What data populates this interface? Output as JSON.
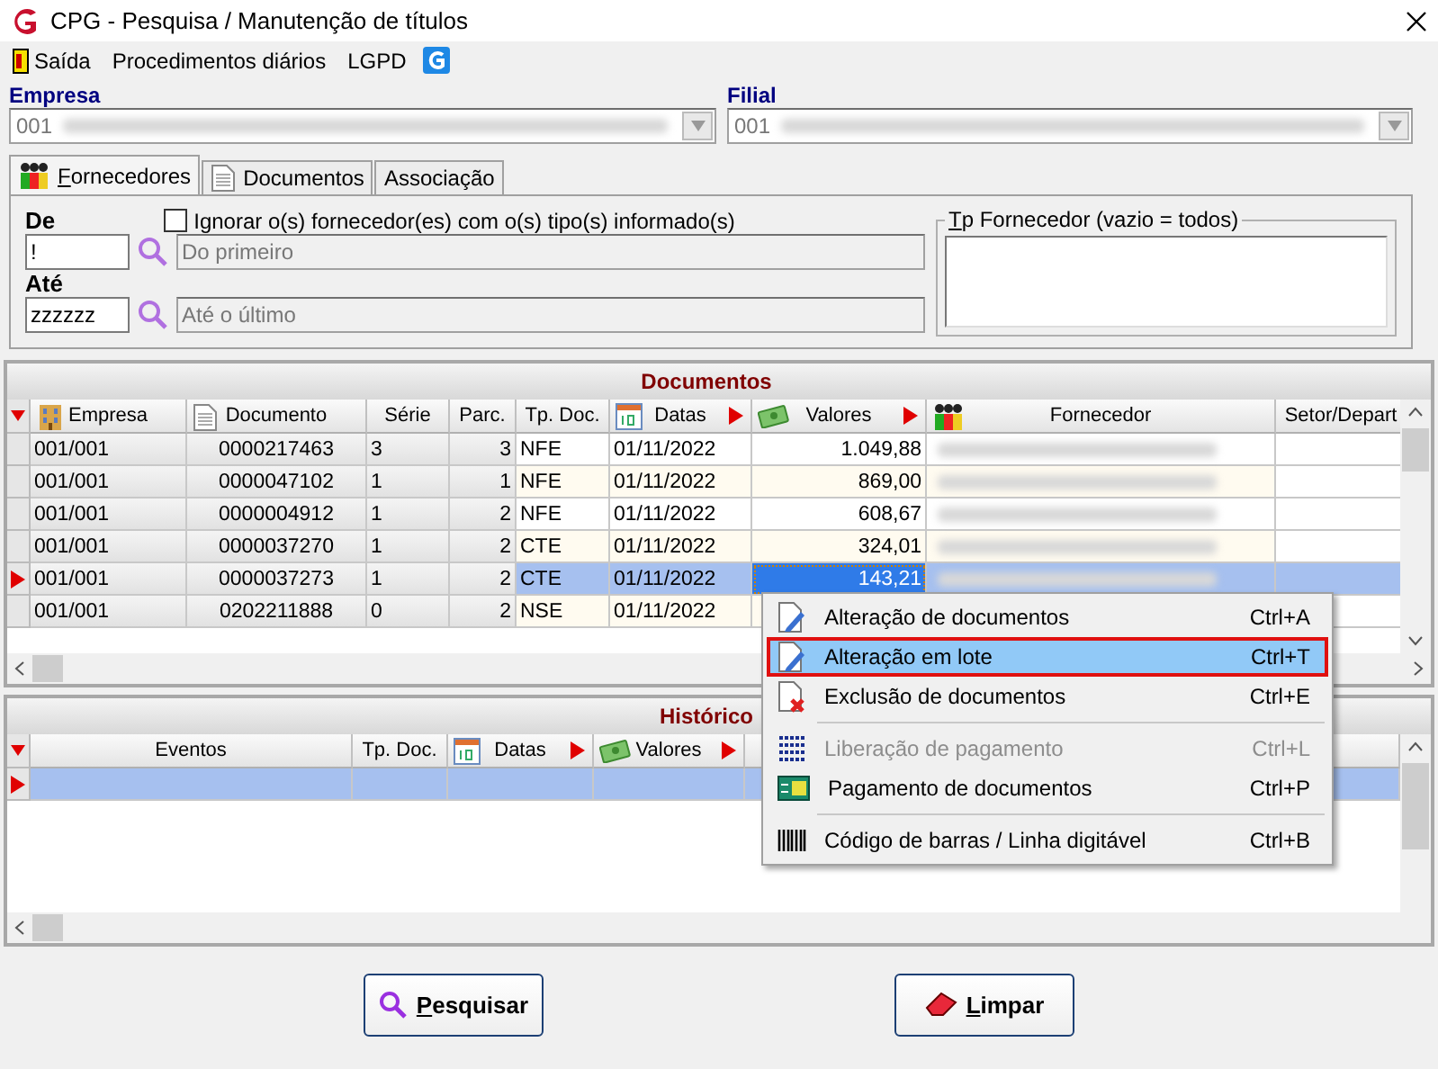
{
  "window": {
    "title": "CPG - Pesquisa / Manutenção de títulos"
  },
  "menu": [
    {
      "label": "Saída",
      "kind": "exit"
    },
    {
      "label": "Procedimentos diários",
      "kind": "text"
    },
    {
      "label": "LGPD",
      "kind": "text"
    }
  ],
  "empresa": {
    "label": "Empresa",
    "value": "001"
  },
  "filial": {
    "label": "Filial",
    "value": "001"
  },
  "tabs": [
    {
      "label": "Fornecedores",
      "selected": true,
      "kind": "supplier"
    },
    {
      "label": "Documentos",
      "selected": false,
      "kind": "document"
    },
    {
      "label": "Associação",
      "selected": false,
      "kind": "text"
    }
  ],
  "filter": {
    "from_label": "De",
    "from_value": "!",
    "from_placeholder": "Do primeiro",
    "to_label": "Até",
    "to_value": "zzzzzz",
    "to_placeholder": "Até o último",
    "ignore": {
      "label": "Ignorar o(s) fornecedor(es) com o(s) tipo(s) informado(s)",
      "checked": false
    },
    "type_group": "Tp Fornecedor (vazio = todos)"
  },
  "documents": {
    "title": "Documentos",
    "columns": [
      {
        "label": "Empresa",
        "kind": "company"
      },
      {
        "label": "Documento",
        "kind": "document"
      },
      {
        "label": "Série",
        "kind": "plain"
      },
      {
        "label": "Parc.",
        "kind": "plain"
      },
      {
        "label": "Tp. Doc.",
        "kind": "plain"
      },
      {
        "label": "Datas",
        "kind": "date"
      },
      {
        "label": "Valores",
        "kind": "money"
      },
      {
        "label": "Fornecedor",
        "kind": "supplier"
      },
      {
        "label": "Setor/Depart",
        "kind": "plain"
      }
    ],
    "rows": [
      {
        "empresa": "001/001",
        "documento": "0000217463",
        "serie": "3",
        "parcela": "3",
        "tipo": "NFE",
        "data": "01/11/2022",
        "valor": "1.049,88",
        "selected": false
      },
      {
        "empresa": "001/001",
        "documento": "0000047102",
        "serie": "1",
        "parcela": "1",
        "tipo": "NFE",
        "data": "01/11/2022",
        "valor": "869,00",
        "selected": false
      },
      {
        "empresa": "001/001",
        "documento": "0000004912",
        "serie": "1",
        "parcela": "2",
        "tipo": "NFE",
        "data": "01/11/2022",
        "valor": "608,67",
        "selected": false
      },
      {
        "empresa": "001/001",
        "documento": "0000037270",
        "serie": "1",
        "parcela": "2",
        "tipo": "CTE",
        "data": "01/11/2022",
        "valor": "324,01",
        "selected": false
      },
      {
        "empresa": "001/001",
        "documento": "0000037273",
        "serie": "1",
        "parcela": "2",
        "tipo": "CTE",
        "data": "01/11/2022",
        "valor": "143,21",
        "selected": true
      },
      {
        "empresa": "001/001",
        "documento": "0202211888",
        "serie": "0",
        "parcela": "2",
        "tipo": "NSE",
        "data": "01/11/2022",
        "valor": "",
        "selected": false
      }
    ]
  },
  "history": {
    "title": "Histórico",
    "columns": [
      {
        "label": "Eventos",
        "kind": "plain"
      },
      {
        "label": "Tp. Doc.",
        "kind": "plain"
      },
      {
        "label": "Datas",
        "kind": "date"
      },
      {
        "label": "Valores",
        "kind": "money"
      },
      {
        "kind": "info"
      }
    ],
    "rows": [
      {
        "selected": true
      }
    ]
  },
  "context_menu": [
    {
      "label": "Alteração de documentos",
      "shortcut": "Ctrl+A",
      "kind": "edit",
      "disabled": false,
      "selected": false
    },
    {
      "label": "Alteração em lote",
      "shortcut": "Ctrl+T",
      "kind": "edit",
      "disabled": false,
      "selected": true
    },
    {
      "label": "Exclusão de documentos",
      "shortcut": "Ctrl+E",
      "kind": "delete",
      "disabled": false,
      "selected": false
    },
    {
      "kind": "separator"
    },
    {
      "label": "Liberação de pagamento",
      "shortcut": "Ctrl+L",
      "kind": "release",
      "disabled": true,
      "selected": false
    },
    {
      "label": "Pagamento de documentos",
      "shortcut": "Ctrl+P",
      "kind": "payment",
      "disabled": false,
      "selected": false
    },
    {
      "kind": "separator"
    },
    {
      "label": "Código de barras / Linha digitável",
      "shortcut": "Ctrl+B",
      "kind": "barcode",
      "disabled": false,
      "selected": false
    }
  ],
  "buttons": [
    {
      "label": "Pesquisar",
      "kind": "search"
    },
    {
      "label": "Limpar",
      "kind": "clear"
    }
  ]
}
